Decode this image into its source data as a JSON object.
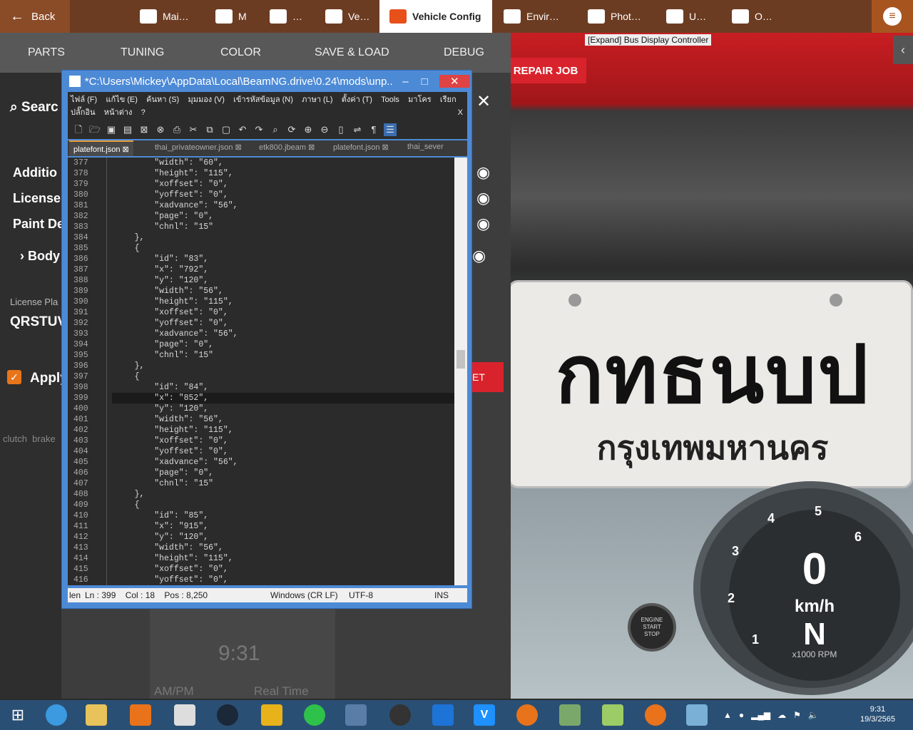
{
  "topbar": {
    "back": "Back",
    "items": [
      "Mai…",
      "M",
      "…",
      "Ve…",
      "Vehicle Config",
      "Envir…",
      "Phot…",
      "U…",
      "O…"
    ]
  },
  "scene": {
    "caption": "[Expand] Bus Display Controller",
    "repair_job": "REPAIR JOB",
    "plate_line1": "กทธนบป",
    "plate_line2": "กรุงเทพมหานคร",
    "speed": "0",
    "speed_unit": "km/h",
    "gear": "N",
    "rpm_label": "x1000 RPM",
    "gauge_numbers": [
      "1",
      "2",
      "3",
      "4",
      "5",
      "6"
    ],
    "engine_button": [
      "ENGINE",
      "START",
      "STOP"
    ]
  },
  "panel": {
    "tabs": [
      "PARTS",
      "TUNING",
      "COLOR",
      "SAVE & LOAD",
      "DEBUG"
    ],
    "search": "Searc",
    "left_items": [
      "Additio",
      "License",
      "Paint De",
      "Body"
    ],
    "license_label": "License Pla",
    "license_value": "QRSTUV",
    "apply": "Apply",
    "pedals": "clutch  brake",
    "clock_time": "9:31",
    "ampm": "AM/PM",
    "realtime": "Real Time"
  },
  "notepad": {
    "title": "*C:\\Users\\Mickey\\AppData\\Local\\BeamNG.drive\\0.24\\mods\\unp...",
    "menu": [
      "ไฟล์ (F)",
      "แก้ไข (E)",
      "ค้นหา (S)",
      "มุมมอง (V)",
      "เข้ารหัสข้อมูล (N)",
      "ภาษา (L)",
      "ตั้งค่า (T)",
      "Tools",
      "มาโคร",
      "เรียก",
      "ปลั๊กอิน",
      "หน้าต่าง",
      "?"
    ],
    "tabs": [
      "platefont.json",
      "thai_privateowner.json",
      "etk800.jbeam",
      "platefont.json",
      "thai_sever"
    ],
    "lines": [
      {
        "n": "377",
        "t": "        \"width\": \"60\","
      },
      {
        "n": "378",
        "t": "        \"height\": \"115\","
      },
      {
        "n": "379",
        "t": "        \"xoffset\": \"0\","
      },
      {
        "n": "380",
        "t": "        \"yoffset\": \"0\","
      },
      {
        "n": "381",
        "t": "        \"xadvance\": \"56\","
      },
      {
        "n": "382",
        "t": "        \"page\": \"0\","
      },
      {
        "n": "383",
        "t": "        \"chnl\": \"15\""
      },
      {
        "n": "384",
        "t": "    },"
      },
      {
        "n": "385",
        "t": "    {"
      },
      {
        "n": "386",
        "t": "        \"id\": \"83\","
      },
      {
        "n": "387",
        "t": "        \"x\": \"792\","
      },
      {
        "n": "388",
        "t": "        \"y\": \"120\","
      },
      {
        "n": "389",
        "t": "        \"width\": \"56\","
      },
      {
        "n": "390",
        "t": "        \"height\": \"115\","
      },
      {
        "n": "391",
        "t": "        \"xoffset\": \"0\","
      },
      {
        "n": "392",
        "t": "        \"yoffset\": \"0\","
      },
      {
        "n": "393",
        "t": "        \"xadvance\": \"56\","
      },
      {
        "n": "394",
        "t": "        \"page\": \"0\","
      },
      {
        "n": "395",
        "t": "        \"chnl\": \"15\""
      },
      {
        "n": "396",
        "t": "    },"
      },
      {
        "n": "397",
        "t": "    {"
      },
      {
        "n": "398",
        "t": "        \"id\": \"84\","
      },
      {
        "n": "399",
        "t": "        \"x\": \"852\","
      },
      {
        "n": "400",
        "t": "        \"y\": \"120\","
      },
      {
        "n": "401",
        "t": "        \"width\": \"56\","
      },
      {
        "n": "402",
        "t": "        \"height\": \"115\","
      },
      {
        "n": "403",
        "t": "        \"xoffset\": \"0\","
      },
      {
        "n": "404",
        "t": "        \"yoffset\": \"0\","
      },
      {
        "n": "405",
        "t": "        \"xadvance\": \"56\","
      },
      {
        "n": "406",
        "t": "        \"page\": \"0\","
      },
      {
        "n": "407",
        "t": "        \"chnl\": \"15\""
      },
      {
        "n": "408",
        "t": "    },"
      },
      {
        "n": "409",
        "t": "    {"
      },
      {
        "n": "410",
        "t": "        \"id\": \"85\","
      },
      {
        "n": "411",
        "t": "        \"x\": \"915\","
      },
      {
        "n": "412",
        "t": "        \"y\": \"120\","
      },
      {
        "n": "413",
        "t": "        \"width\": \"56\","
      },
      {
        "n": "414",
        "t": "        \"height\": \"115\","
      },
      {
        "n": "415",
        "t": "        \"xoffset\": \"0\","
      },
      {
        "n": "416",
        "t": "        \"yoffset\": \"0\","
      }
    ],
    "highlight_line": "399",
    "status": [
      "len",
      "Ln : 399    Col : 18    Pos : 8,250",
      "Windows (CR LF)",
      "UTF-8",
      "INS"
    ]
  },
  "taskbar": {
    "clock_time": "9:31",
    "clock_date": "19/3/2565"
  }
}
